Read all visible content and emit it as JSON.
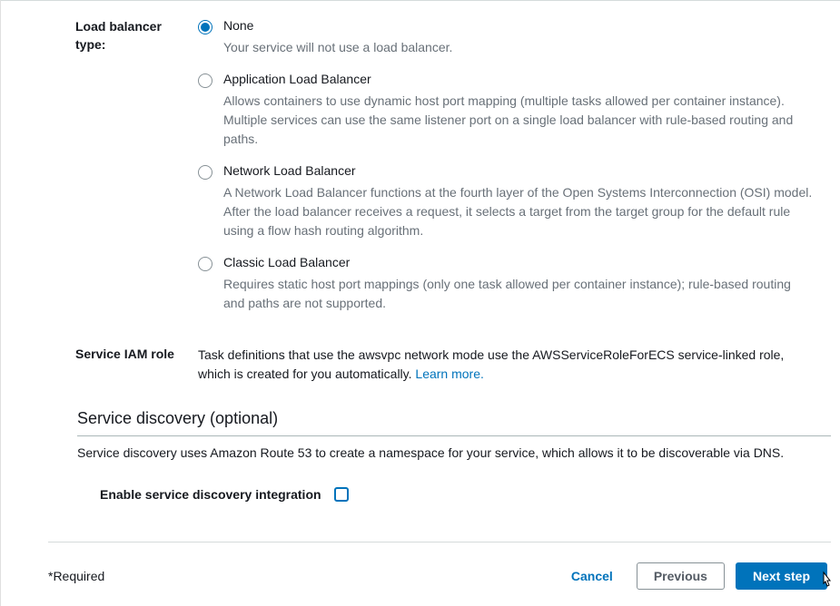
{
  "loadBalancer": {
    "label": "Load balancer type:",
    "options": [
      {
        "title": "None",
        "desc": "Your service will not use a load balancer.",
        "selected": true
      },
      {
        "title": "Application Load Balancer",
        "desc": "Allows containers to use dynamic host port mapping (multiple tasks allowed per container instance). Multiple services can use the same listener port on a single load balancer with rule-based routing and paths.",
        "selected": false
      },
      {
        "title": "Network Load Balancer",
        "desc": "A Network Load Balancer functions at the fourth layer of the Open Systems Interconnection (OSI) model. After the load balancer receives a request, it selects a target from the target group for the default rule using a flow hash routing algorithm.",
        "selected": false
      },
      {
        "title": "Classic Load Balancer",
        "desc": "Requires static host port mappings (only one task allowed per container instance); rule-based routing and paths are not supported.",
        "selected": false
      }
    ]
  },
  "serviceIam": {
    "label": "Service IAM role",
    "text": "Task definitions that use the awsvpc network mode use the AWSServiceRoleForECS service-linked role, which is created for you automatically. ",
    "learnMore": "Learn more."
  },
  "serviceDiscovery": {
    "header": "Service discovery (optional)",
    "sub": "Service discovery uses Amazon Route 53 to create a namespace for your service, which allows it to be discoverable via DNS.",
    "checkboxLabel": "Enable service discovery integration"
  },
  "footer": {
    "required": "*Required",
    "cancel": "Cancel",
    "previous": "Previous",
    "next": "Next step"
  }
}
